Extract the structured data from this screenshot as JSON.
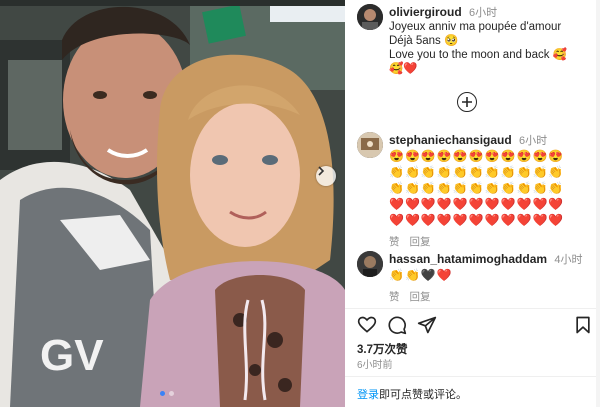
{
  "post": {
    "author": "oliviergiroud",
    "time": "6小时",
    "caption_lines": [
      "Joyeux anniv ma poupée d'amour",
      "Déjà 5ans 🥺",
      "Love you to the moon and back 🥰",
      "🥰❤️"
    ]
  },
  "comments": [
    {
      "user": "stephaniechansigaud",
      "time": "6小时",
      "rows": [
        "😍😍😍😍😍😍😍😍😍😍😍",
        "👏👏👏👏👏👏👏👏👏👏👏",
        "👏👏👏👏👏👏👏👏👏👏👏",
        "❤️❤️❤️❤️❤️❤️❤️❤️❤️❤️❤️",
        "❤️❤️❤️❤️❤️❤️❤️❤️❤️❤️❤️"
      ],
      "like_label": "赞",
      "reply_label": "回复"
    },
    {
      "user": "hassan_hatamimoghaddam",
      "time": "4小时",
      "rows": [
        "👏👏🖤❤️"
      ],
      "like_label": "赞",
      "reply_label": "回复"
    }
  ],
  "likes": "3.7万次赞",
  "post_time": "6小时前",
  "login_prompt": {
    "link": "登录",
    "text": "即可点赞或评论。"
  },
  "icons": {
    "load_more": "plus-circle-icon",
    "like": "heart-icon",
    "comment": "comment-bubble-icon",
    "share": "paper-plane-icon",
    "save": "bookmark-icon",
    "next": "chevron-right-icon"
  },
  "colors": {
    "link_blue": "#0095f6",
    "muted": "#8e8e8e",
    "text": "#262626"
  },
  "carousel": {
    "count": 2,
    "active": 1
  }
}
